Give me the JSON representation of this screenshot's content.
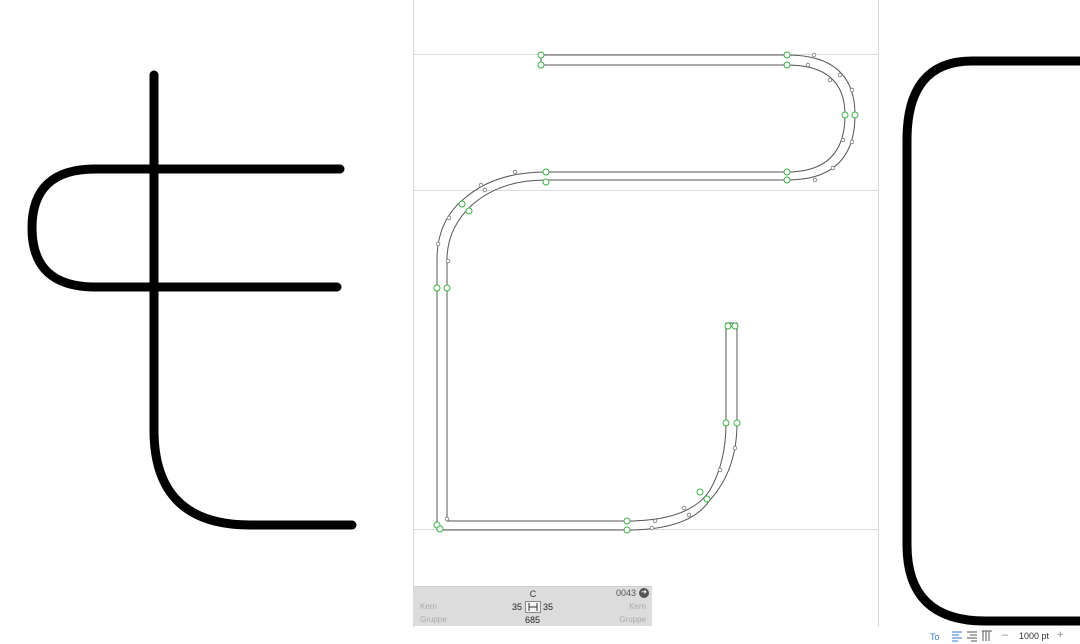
{
  "info_panel": {
    "glyph_name": "C",
    "unicode": "0043",
    "kern_label_left": "Kern",
    "kern_label_right": "Kern",
    "group_label_left": "Gruppe",
    "group_label_right": "Gruppe",
    "lsb": "35",
    "rsb": "35",
    "width": "685"
  },
  "status_bar": {
    "zoom": "1000 pt",
    "minus": "–",
    "plus": "+"
  },
  "colors": {
    "stroke": "#000000",
    "node": "#3cb043",
    "outline": "#555555",
    "guide": "#d8d8d8",
    "accent": "#3478d6"
  }
}
